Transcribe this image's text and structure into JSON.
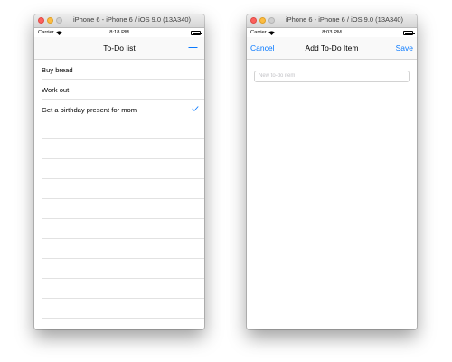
{
  "left": {
    "window_title": "iPhone 6 - iPhone 6 / iOS 9.0 (13A340)",
    "status": {
      "carrier": "Carrier",
      "time": "8:18 PM"
    },
    "nav": {
      "title": "To-Do list",
      "add_icon": "plus-icon"
    },
    "items": [
      {
        "label": "Buy bread",
        "completed": false
      },
      {
        "label": "Work out",
        "completed": false
      },
      {
        "label": "Get a birthday present for mom",
        "completed": true
      }
    ]
  },
  "right": {
    "window_title": "iPhone 6 - iPhone 6 / iOS 9.0 (13A340)",
    "status": {
      "carrier": "Carrier",
      "time": "8:03 PM"
    },
    "nav": {
      "title": "Add To-Do Item",
      "cancel_label": "Cancel",
      "save_label": "Save"
    },
    "field": {
      "placeholder": "New to-do item",
      "value": ""
    }
  },
  "colors": {
    "tint": "#0a7aff",
    "separator": "#e2e2e2"
  }
}
